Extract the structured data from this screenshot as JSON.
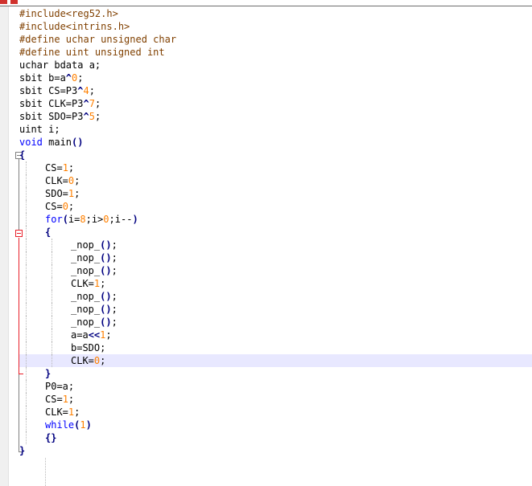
{
  "editor": {
    "colors": {
      "keyword": "#0000ff",
      "preprocessor": "#804000",
      "number": "#ff8000",
      "operator": "#000080",
      "current_line": "#e8e8ff",
      "fold_marker_active": "#e8202a"
    },
    "current_line_index": 27,
    "lines": [
      {
        "tokens": [
          {
            "t": "#include<reg52.h>",
            "c": "pp"
          }
        ]
      },
      {
        "tokens": [
          {
            "t": "#include<intrins.h>",
            "c": "pp"
          }
        ]
      },
      {
        "tokens": [
          {
            "t": "#define uchar unsigned char",
            "c": "pp"
          }
        ]
      },
      {
        "tokens": [
          {
            "t": "#define uint unsigned int",
            "c": "pp"
          }
        ]
      },
      {
        "tokens": [
          {
            "t": "uchar bdata a;"
          }
        ]
      },
      {
        "tokens": [
          {
            "t": "sbit b=a"
          },
          {
            "t": "^",
            "c": "op"
          },
          {
            "t": "0",
            "c": "num"
          },
          {
            "t": ";"
          }
        ]
      },
      {
        "tokens": [
          {
            "t": "sbit CS=P3"
          },
          {
            "t": "^",
            "c": "op"
          },
          {
            "t": "4",
            "c": "num"
          },
          {
            "t": ";"
          }
        ]
      },
      {
        "tokens": [
          {
            "t": "sbit CLK=P3"
          },
          {
            "t": "^",
            "c": "op"
          },
          {
            "t": "7",
            "c": "num"
          },
          {
            "t": ";"
          }
        ]
      },
      {
        "tokens": [
          {
            "t": "sbit SDO=P3"
          },
          {
            "t": "^",
            "c": "op"
          },
          {
            "t": "5",
            "c": "num"
          },
          {
            "t": ";"
          }
        ]
      },
      {
        "tokens": [
          {
            "t": "uint i;"
          }
        ]
      },
      {
        "tokens": [
          {
            "t": "void",
            "c": "kw"
          },
          {
            "t": " main"
          },
          {
            "t": "()",
            "c": "op"
          }
        ]
      },
      {
        "tokens": [
          {
            "t": "{",
            "c": "op"
          }
        ]
      },
      {
        "indent": 1,
        "tokens": [
          {
            "t": "CS="
          },
          {
            "t": "1",
            "c": "num"
          },
          {
            "t": ";"
          }
        ]
      },
      {
        "indent": 1,
        "tokens": [
          {
            "t": "CLK="
          },
          {
            "t": "0",
            "c": "num"
          },
          {
            "t": ";"
          }
        ]
      },
      {
        "indent": 1,
        "tokens": [
          {
            "t": "SDO="
          },
          {
            "t": "1",
            "c": "num"
          },
          {
            "t": ";"
          }
        ]
      },
      {
        "indent": 1,
        "tokens": [
          {
            "t": "CS="
          },
          {
            "t": "0",
            "c": "num"
          },
          {
            "t": ";"
          }
        ]
      },
      {
        "indent": 1,
        "tokens": [
          {
            "t": "for",
            "c": "kw"
          },
          {
            "t": "(",
            "c": "op"
          },
          {
            "t": "i="
          },
          {
            "t": "8",
            "c": "num"
          },
          {
            "t": ";i>"
          },
          {
            "t": "0",
            "c": "num"
          },
          {
            "t": ";i--"
          },
          {
            "t": ")",
            "c": "op"
          }
        ]
      },
      {
        "indent": 1,
        "tokens": [
          {
            "t": "{",
            "c": "op"
          }
        ]
      },
      {
        "indent": 2,
        "tokens": [
          {
            "t": "_nop_"
          },
          {
            "t": "()",
            "c": "op"
          },
          {
            "t": ";"
          }
        ]
      },
      {
        "indent": 2,
        "tokens": [
          {
            "t": "_nop_"
          },
          {
            "t": "()",
            "c": "op"
          },
          {
            "t": ";"
          }
        ]
      },
      {
        "indent": 2,
        "tokens": [
          {
            "t": "_nop_"
          },
          {
            "t": "()",
            "c": "op"
          },
          {
            "t": ";"
          }
        ]
      },
      {
        "indent": 2,
        "tokens": [
          {
            "t": "CLK="
          },
          {
            "t": "1",
            "c": "num"
          },
          {
            "t": ";"
          }
        ]
      },
      {
        "indent": 2,
        "tokens": [
          {
            "t": "_nop_"
          },
          {
            "t": "()",
            "c": "op"
          },
          {
            "t": ";"
          }
        ]
      },
      {
        "indent": 2,
        "tokens": [
          {
            "t": "_nop_"
          },
          {
            "t": "()",
            "c": "op"
          },
          {
            "t": ";"
          }
        ]
      },
      {
        "indent": 2,
        "tokens": [
          {
            "t": "_nop_"
          },
          {
            "t": "()",
            "c": "op"
          },
          {
            "t": ";"
          }
        ]
      },
      {
        "indent": 2,
        "tokens": [
          {
            "t": "a=a"
          },
          {
            "t": "<<",
            "c": "op"
          },
          {
            "t": "1",
            "c": "num"
          },
          {
            "t": ";"
          }
        ]
      },
      {
        "indent": 2,
        "tokens": [
          {
            "t": "b=SDO;"
          }
        ]
      },
      {
        "indent": 2,
        "tokens": [
          {
            "t": "CLK="
          },
          {
            "t": "0",
            "c": "num"
          },
          {
            "t": ";"
          }
        ]
      },
      {
        "indent": 1,
        "tokens": [
          {
            "t": "}",
            "c": "op"
          }
        ]
      },
      {
        "indent": 1,
        "tokens": [
          {
            "t": "P0=a;"
          }
        ]
      },
      {
        "indent": 1,
        "tokens": [
          {
            "t": "CS="
          },
          {
            "t": "1",
            "c": "num"
          },
          {
            "t": ";"
          }
        ]
      },
      {
        "indent": 1,
        "tokens": [
          {
            "t": "CLK="
          },
          {
            "t": "1",
            "c": "num"
          },
          {
            "t": ";"
          }
        ]
      },
      {
        "indent": 1,
        "tokens": [
          {
            "t": "while",
            "c": "kw"
          },
          {
            "t": "(",
            "c": "op"
          },
          {
            "t": "1",
            "c": "num"
          },
          {
            "t": ")",
            "c": "op"
          }
        ]
      },
      {
        "indent": 1,
        "tokens": [
          {
            "t": "{}",
            "c": "op"
          }
        ]
      },
      {
        "tokens": [
          {
            "t": "}",
            "c": "op"
          }
        ]
      }
    ]
  }
}
